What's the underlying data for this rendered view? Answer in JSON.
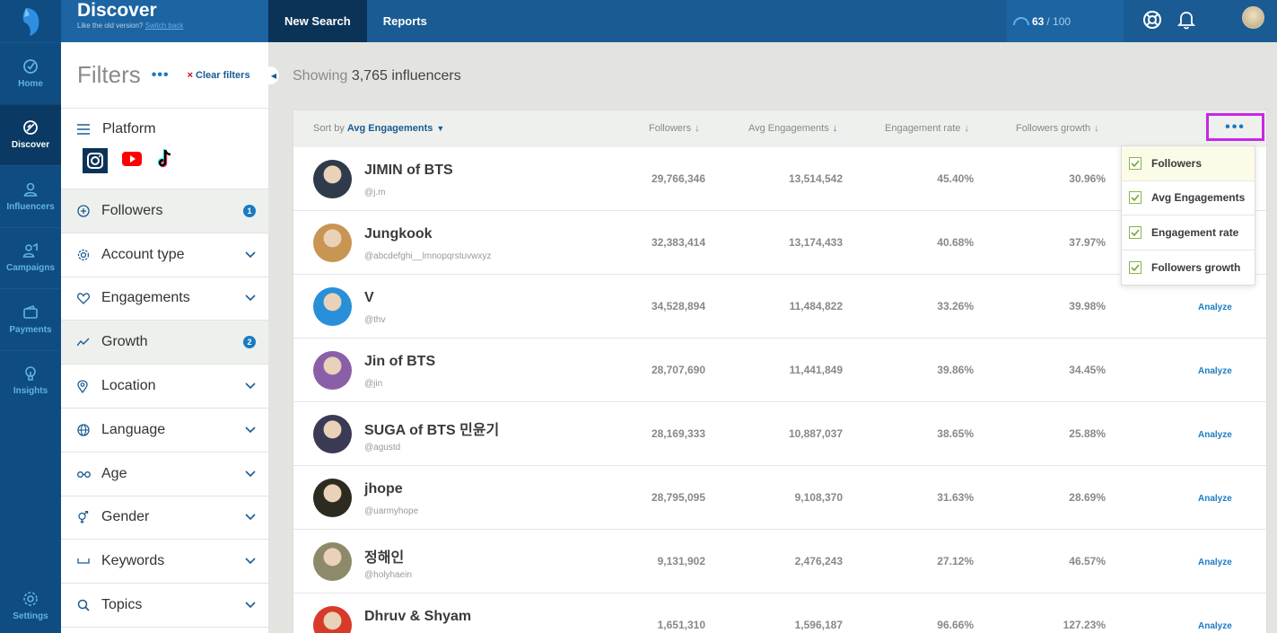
{
  "app": {
    "title": "Discover",
    "subtitle": "Like the old version?",
    "switch_back": "Switch back"
  },
  "rail": {
    "items": [
      {
        "label": "Home",
        "icon": "home-icon"
      },
      {
        "label": "Discover",
        "icon": "discover-icon"
      },
      {
        "label": "Influencers",
        "icon": "user-icon"
      },
      {
        "label": "Campaigns",
        "icon": "campaigns-icon"
      },
      {
        "label": "Payments",
        "icon": "wallet-icon"
      },
      {
        "label": "Insights",
        "icon": "lightbulb-icon"
      }
    ],
    "settings": "Settings"
  },
  "topnav": {
    "new_search": "New Search",
    "reports": "Reports",
    "credits_used": "63",
    "credits_total": "/ 100"
  },
  "filters": {
    "title": "Filters",
    "more": "•••",
    "clear": "Clear filters",
    "clear_x": "×",
    "platform": "Platform",
    "items": [
      {
        "label": "Followers",
        "icon": "plus-circle-icon",
        "badge": "1"
      },
      {
        "label": "Account type",
        "icon": "gear-icon"
      },
      {
        "label": "Engagements",
        "icon": "heart-icon"
      },
      {
        "label": "Growth",
        "icon": "trend-icon",
        "badge": "2"
      },
      {
        "label": "Location",
        "icon": "pin-icon"
      },
      {
        "label": "Language",
        "icon": "globe-icon"
      },
      {
        "label": "Age",
        "icon": "glasses-icon"
      },
      {
        "label": "Gender",
        "icon": "gender-icon"
      },
      {
        "label": "Keywords",
        "icon": "bracket-icon"
      },
      {
        "label": "Topics",
        "icon": "search-icon"
      }
    ]
  },
  "results": {
    "showing_prefix": "Showing",
    "count_text": "3,765 influencers"
  },
  "table": {
    "sort_prefix": "Sort by",
    "sort_value": "Avg Engagements",
    "columns": [
      "Followers",
      "Avg Engagements",
      "Engagement rate",
      "Followers growth"
    ],
    "more": "•••",
    "analyze_label": "Analyze",
    "rows": [
      {
        "name": "JIMIN of BTS",
        "handle": "@j.m",
        "followers": "29,766,346",
        "avg_eng": "13,514,542",
        "eng_rate": "45.40%",
        "growth": "30.96%",
        "avatar_color": "#2f3a4a"
      },
      {
        "name": "Jungkook",
        "handle": "@abcdefghi__lmnopqrstuvwxyz",
        "followers": "32,383,414",
        "avg_eng": "13,174,433",
        "eng_rate": "40.68%",
        "growth": "37.97%",
        "avatar_color": "#c89552"
      },
      {
        "name": "V",
        "handle": "@thv",
        "followers": "34,528,894",
        "avg_eng": "11,484,822",
        "eng_rate": "33.26%",
        "growth": "39.98%",
        "avatar_color": "#2a8fd9"
      },
      {
        "name": "Jin of BTS",
        "handle": "@jin",
        "followers": "28,707,690",
        "avg_eng": "11,441,849",
        "eng_rate": "39.86%",
        "growth": "34.45%",
        "avatar_color": "#8a5fa8"
      },
      {
        "name": "SUGA of BTS 민윤기",
        "handle": "@agustd",
        "followers": "28,169,333",
        "avg_eng": "10,887,037",
        "eng_rate": "38.65%",
        "growth": "25.88%",
        "avatar_color": "#3b3a55"
      },
      {
        "name": "jhope",
        "handle": "@uarmyhope",
        "followers": "28,795,095",
        "avg_eng": "9,108,370",
        "eng_rate": "31.63%",
        "growth": "28.69%",
        "avatar_color": "#2d2a20"
      },
      {
        "name": "정해인",
        "handle": "@holyhaein",
        "followers": "9,131,902",
        "avg_eng": "2,476,243",
        "eng_rate": "27.12%",
        "growth": "46.57%",
        "avatar_color": "#8d8a6a"
      },
      {
        "name": "Dhruv & Shyam",
        "handle": "",
        "followers": "1,651,310",
        "avg_eng": "1,596,187",
        "eng_rate": "96.66%",
        "growth": "127.23%",
        "avatar_color": "#d83a2a"
      }
    ]
  },
  "columns_menu": {
    "items": [
      "Followers",
      "Avg Engagements",
      "Engagement rate",
      "Followers growth"
    ]
  },
  "colors": {
    "accent": "#1a7bc2",
    "nav_dark": "#0f4c81",
    "highlight": "#c727e5"
  }
}
